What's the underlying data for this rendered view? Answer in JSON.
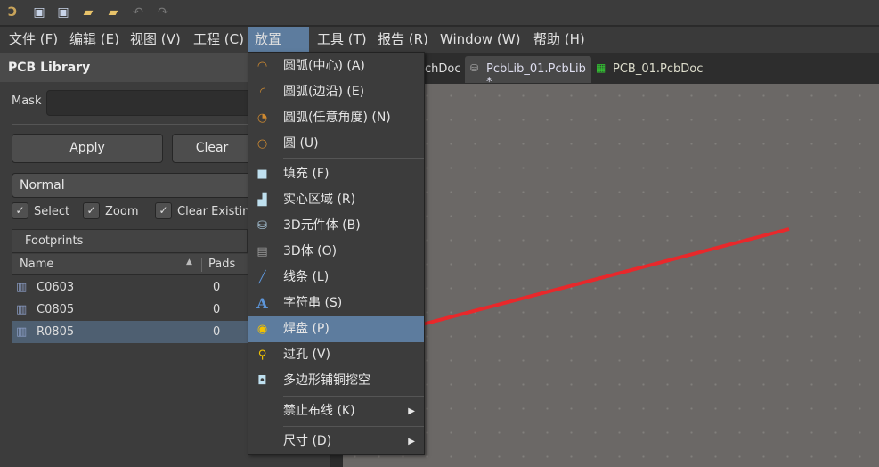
{
  "toolbar": {
    "icons": [
      "altium-logo-icon",
      "save-icon",
      "save-all-icon",
      "open-icon",
      "open-project-icon",
      "undo-icon",
      "redo-icon"
    ]
  },
  "menubar": [
    {
      "label": "文件 (F)"
    },
    {
      "label": "编辑 (E)"
    },
    {
      "label": "视图 (V)"
    },
    {
      "label": "工程 (C)"
    },
    {
      "label": "放置 (P)",
      "active": true
    },
    {
      "label": "工具 (T)"
    },
    {
      "label": "报告 (R)"
    },
    {
      "label": "Window (W)"
    },
    {
      "label": "帮助 (H)"
    }
  ],
  "panel": {
    "title": "PCB Library",
    "mask_label": "Mask",
    "mask_value": "",
    "apply": "Apply",
    "clear": "Clear",
    "mode": "Normal",
    "checks": [
      {
        "label": "Select",
        "checked": true
      },
      {
        "label": "Zoom",
        "checked": true
      },
      {
        "label": "Clear Existing",
        "checked": true
      }
    ],
    "section": "Footprints",
    "columns": [
      "Name",
      "Pads"
    ],
    "rows": [
      {
        "name": "C0603",
        "pads": "0"
      },
      {
        "name": "C0805",
        "pads": "0"
      },
      {
        "name": "R0805",
        "pads": "0",
        "selected": true
      }
    ]
  },
  "tabs": [
    {
      "label": "chDoc"
    },
    {
      "label": "PcbLib_01.PcbLib *",
      "active": true
    },
    {
      "label": "PCB_01.PcbDoc"
    }
  ],
  "menu": {
    "items": [
      {
        "label": "圆弧(中心) (A)",
        "icon": "arc-center-icon"
      },
      {
        "label": "圆弧(边沿) (E)",
        "icon": "arc-edge-icon"
      },
      {
        "label": "圆弧(任意角度) (N)",
        "icon": "arc-any-angle-icon"
      },
      {
        "label": "圆 (U)",
        "icon": "circle-icon"
      },
      {
        "label": "填充 (F)",
        "icon": "fill-icon"
      },
      {
        "label": "实心区域 (R)",
        "icon": "solid-region-icon"
      },
      {
        "label": "3D元件体 (B)",
        "icon": "3d-component-body-icon"
      },
      {
        "label": "3D体 (O)",
        "icon": "3d-body-icon"
      },
      {
        "label": "线条 (L)",
        "icon": "line-icon"
      },
      {
        "label": "字符串 (S)",
        "icon": "string-icon"
      },
      {
        "label": "焊盘 (P)",
        "icon": "pad-icon",
        "highlighted": true
      },
      {
        "label": "过孔 (V)",
        "icon": "via-icon"
      },
      {
        "label": "多边形铺铜挖空",
        "icon": "polygon-cutout-icon"
      },
      {
        "label": "禁止布线 (K)",
        "submenu": true
      },
      {
        "label": "尺寸 (D)",
        "submenu": true
      }
    ]
  },
  "colors": {
    "highlight": "#5d7c9e",
    "arrow": "#e8282b",
    "canvas": "#6b6866"
  }
}
